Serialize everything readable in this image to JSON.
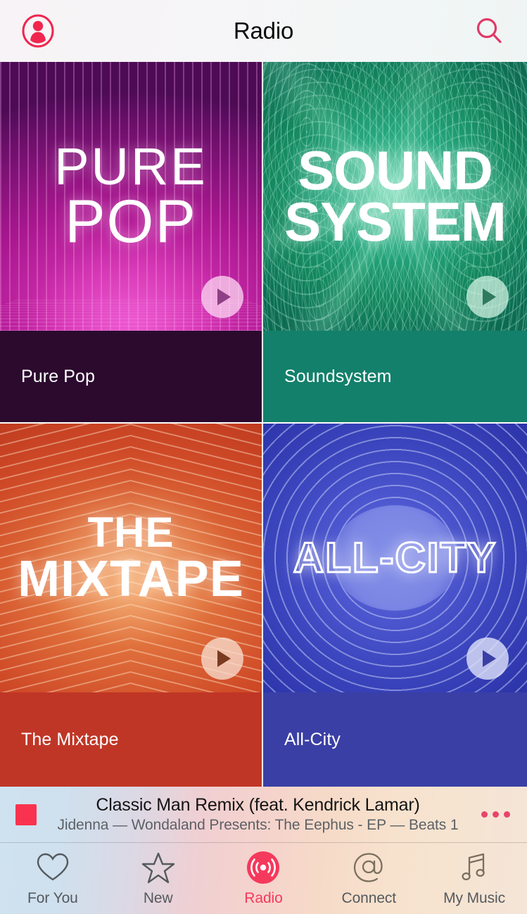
{
  "header": {
    "title": "Radio",
    "profile_icon": "person-circle-icon",
    "search_icon": "search-icon"
  },
  "stations": [
    {
      "id": "pure-pop",
      "art_line1": "PURE",
      "art_line2": "POP",
      "label": "Pure Pop",
      "band_color": "#2b0a2e",
      "play_icon": "play-icon"
    },
    {
      "id": "soundsystem",
      "art_line1": "SOUND",
      "art_line2": "SYSTEM",
      "label": "Soundsystem",
      "band_color": "#13806b",
      "play_icon": "play-icon"
    },
    {
      "id": "the-mixtape",
      "art_line1": "THE",
      "art_line2": "MIXTAPE",
      "label": "The Mixtape",
      "band_color": "#c03626",
      "play_icon": "play-icon"
    },
    {
      "id": "all-city",
      "art_line1": "ALL-CITY",
      "art_line2": "",
      "label": "All-City",
      "band_color": "#3a3fa5",
      "play_icon": "play-icon"
    }
  ],
  "now_playing": {
    "title": "Classic Man Remix (feat. Kendrick Lamar)",
    "subtitle": "Jidenna — Wondaland Presents: The Eephus - EP — Beats 1",
    "artwork_color": "#f9334f",
    "more_icon": "more-dots-icon"
  },
  "tabbar": {
    "accent_color": "#f5395c",
    "items": [
      {
        "id": "for-you",
        "label": "For You",
        "icon": "heart-icon",
        "active": false
      },
      {
        "id": "new",
        "label": "New",
        "icon": "star-icon",
        "active": false
      },
      {
        "id": "radio",
        "label": "Radio",
        "icon": "radio-icon",
        "active": true
      },
      {
        "id": "connect",
        "label": "Connect",
        "icon": "at-sign-icon",
        "active": false
      },
      {
        "id": "my-music",
        "label": "My Music",
        "icon": "music-note-icon",
        "active": false
      }
    ]
  }
}
